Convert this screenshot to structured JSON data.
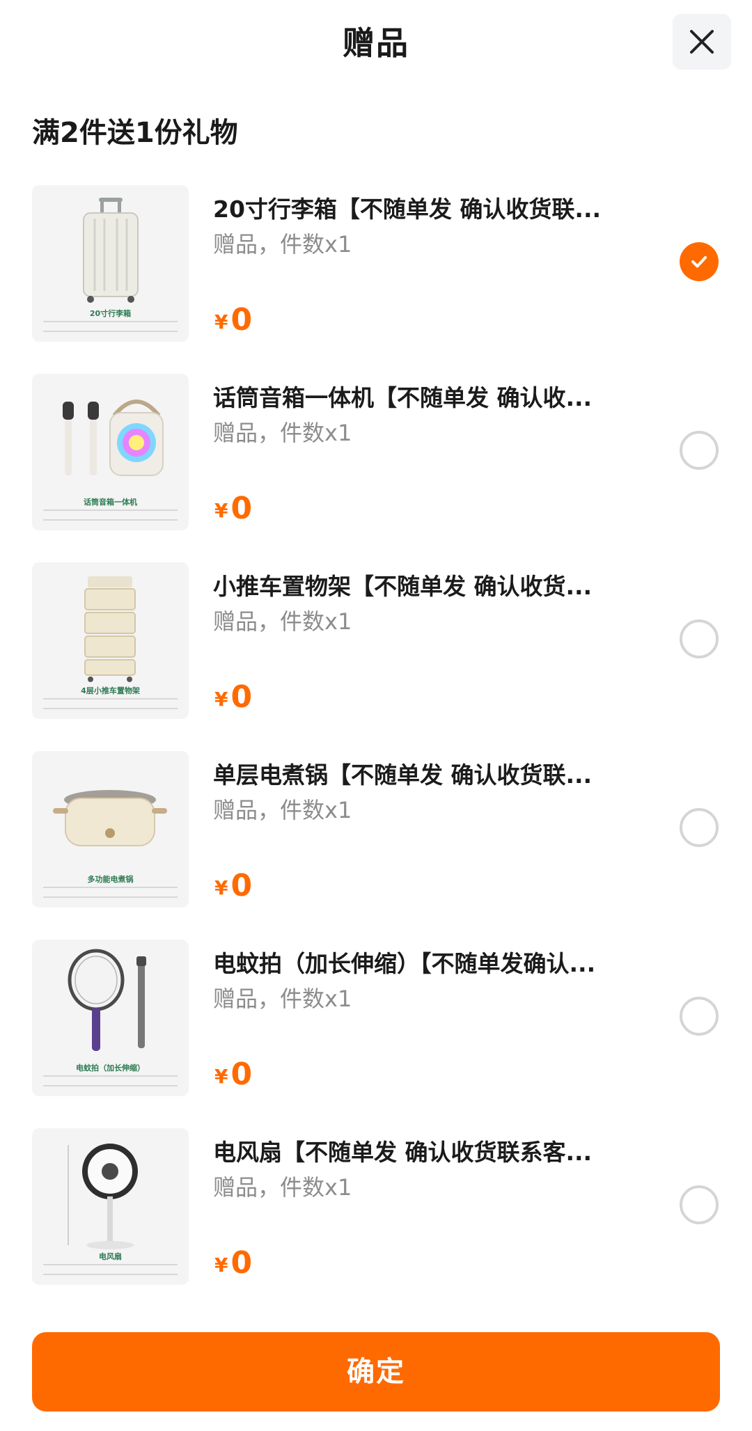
{
  "header": {
    "title": "赠品",
    "close_icon": "close-icon"
  },
  "subtitle": "满2件送1份礼物",
  "items": [
    {
      "name": "20寸行李箱【不随单发 确认收货联...",
      "meta": "赠品，件数x1",
      "price_symbol": "¥",
      "price": "0",
      "selected": true,
      "thumb_caption": "20寸行李箱",
      "icon": "suitcase-image"
    },
    {
      "name": "话筒音箱一体机【不随单发 确认收...",
      "meta": "赠品，件数x1",
      "price_symbol": "¥",
      "price": "0",
      "selected": false,
      "thumb_caption": "话筒音箱一体机",
      "icon": "speaker-microphone-image"
    },
    {
      "name": "小推车置物架【不随单发 确认收货...",
      "meta": "赠品，件数x1",
      "price_symbol": "¥",
      "price": "0",
      "selected": false,
      "thumb_caption": "4层小推车置物架",
      "icon": "cart-shelf-image"
    },
    {
      "name": "单层电煮锅【不随单发 确认收货联...",
      "meta": "赠品，件数x1",
      "price_symbol": "¥",
      "price": "0",
      "selected": false,
      "thumb_caption": "多功能电煮锅",
      "icon": "electric-pot-image"
    },
    {
      "name": "电蚊拍（加长伸缩）【不随单发确认...",
      "meta": "赠品，件数x1",
      "price_symbol": "¥",
      "price": "0",
      "selected": false,
      "thumb_caption": "电蚊拍（加长伸缩）",
      "icon": "mosquito-swatter-image"
    },
    {
      "name": "电风扇【不随单发 确认收货联系客...",
      "meta": "赠品，件数x1",
      "price_symbol": "¥",
      "price": "0",
      "selected": false,
      "thumb_caption": "电风扇",
      "icon": "electric-fan-image"
    }
  ],
  "confirm_label": "确定",
  "colors": {
    "accent": "#ff6a00",
    "muted": "#8c8c8c",
    "radio_border": "#d3d5d8"
  }
}
